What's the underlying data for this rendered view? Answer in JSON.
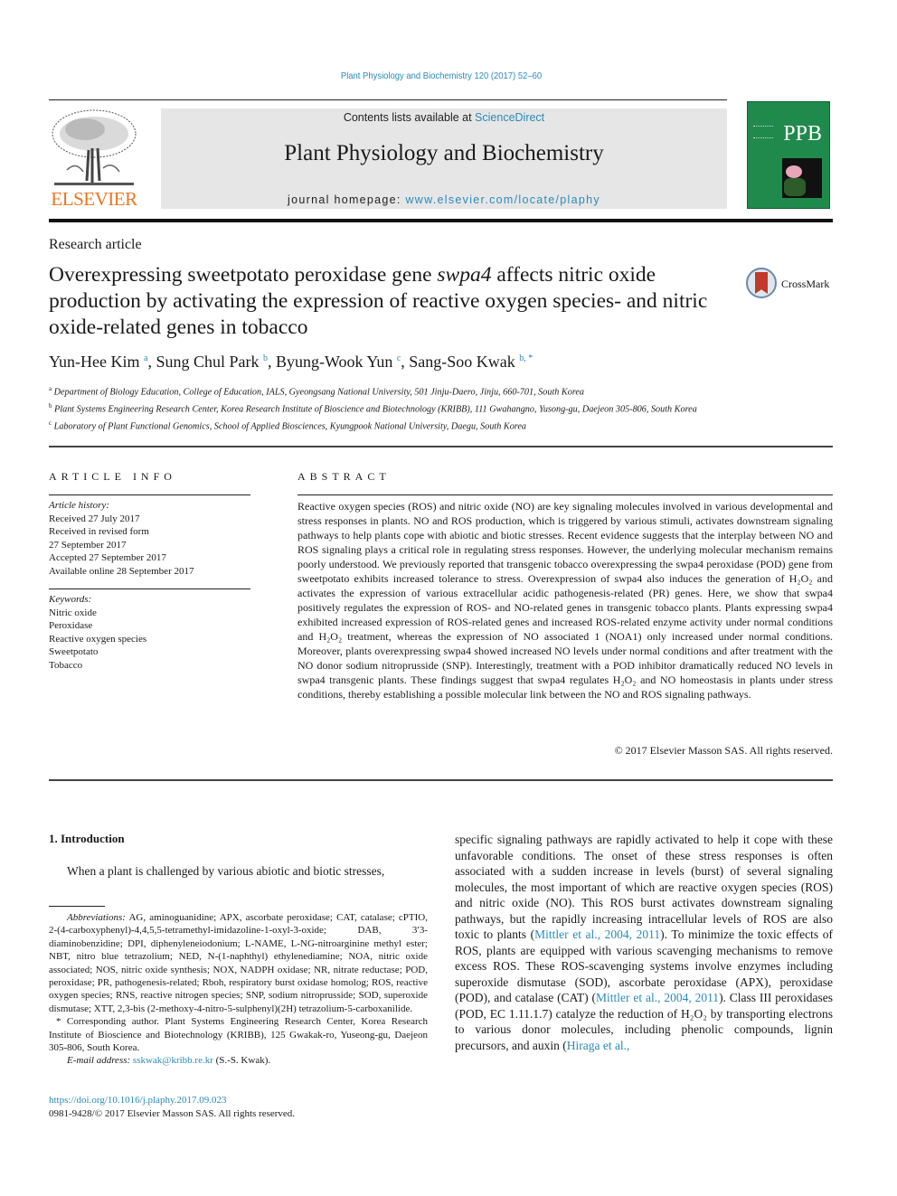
{
  "header": {
    "journal_ref": "Plant Physiology and Biochemistry 120 (2017) 52–60",
    "contents_prefix": "Contents lists available at ",
    "contents_link": "ScienceDirect",
    "journal_title": "Plant Physiology and Biochemistry",
    "homepage_prefix": "journal homepage: ",
    "homepage_link": "www.elsevier.com/locate/plaphy",
    "publisher": "ELSEVIER",
    "cover_label": "PPB",
    "crossmark_label": "CrossMark"
  },
  "article": {
    "type": "Research article",
    "title_part1": "Overexpressing sweetpotato peroxidase gene ",
    "title_gene": "swpa4",
    "title_part2": " affects nitric oxide production by activating the expression of reactive oxygen species- and nitric oxide-related genes in tobacco",
    "authors": [
      {
        "name": "Yun-Hee Kim",
        "sup": "a"
      },
      {
        "name": "Sung Chul Park",
        "sup": "b"
      },
      {
        "name": "Byung-Wook Yun",
        "sup": "c"
      },
      {
        "name": "Sang-Soo Kwak",
        "sup": "b, *"
      }
    ],
    "affiliations": [
      {
        "sup": "a",
        "text": "Department of Biology Education, College of Education, IALS, Gyeongsang National University, 501 Jinju-Daero, Jinju, 660-701, South Korea"
      },
      {
        "sup": "b",
        "text": "Plant Systems Engineering Research Center, Korea Research Institute of Bioscience and Biotechnology (KRIBB), 111 Gwahangno, Yusong-gu, Daejeon 305-806, South Korea"
      },
      {
        "sup": "c",
        "text": "Laboratory of Plant Functional Genomics, School of Applied Biosciences, Kyungpook National University, Daegu, South Korea"
      }
    ]
  },
  "article_info": {
    "heading": "ARTICLE INFO",
    "history_label": "Article history:",
    "history": [
      "Received 27 July 2017",
      "Received in revised form",
      "27 September 2017",
      "Accepted 27 September 2017",
      "Available online 28 September 2017"
    ],
    "keywords_label": "Keywords:",
    "keywords": [
      "Nitric oxide",
      "Peroxidase",
      "Reactive oxygen species",
      "Sweetpotato",
      "Tobacco"
    ]
  },
  "abstract": {
    "heading": "ABSTRACT",
    "text": "Reactive oxygen species (ROS) and nitric oxide (NO) are key signaling molecules involved in various developmental and stress responses in plants. NO and ROS production, which is triggered by various stimuli, activates downstream signaling pathways to help plants cope with abiotic and biotic stresses. Recent evidence suggests that the interplay between NO and ROS signaling plays a critical role in regulating stress responses. However, the underlying molecular mechanism remains poorly understood. We previously reported that transgenic tobacco overexpressing the swpa4 peroxidase (POD) gene from sweetpotato exhibits increased tolerance to stress. Overexpression of swpa4 also induces the generation of H₂O₂ and activates the expression of various extracellular acidic pathogenesis-related (PR) genes. Here, we show that swpa4 positively regulates the expression of ROS- and NO-related genes in transgenic tobacco plants. Plants expressing swpa4 exhibited increased expression of ROS-related genes and increased ROS-related enzyme activity under normal conditions and H₂O₂ treatment, whereas the expression of NO associated 1 (NOA1) only increased under normal conditions. Moreover, plants overexpressing swpa4 showed increased NO levels under normal conditions and after treatment with the NO donor sodium nitroprusside (SNP). Interestingly, treatment with a POD inhibitor dramatically reduced NO levels in swpa4 transgenic plants. These findings suggest that swpa4 regulates H₂O₂ and NO homeostasis in plants under stress conditions, thereby establishing a possible molecular link between the NO and ROS signaling pathways.",
    "copyright": "© 2017 Elsevier Masson SAS. All rights reserved."
  },
  "introduction": {
    "heading": "1.  Introduction",
    "col1_text": "When a plant is challenged by various abiotic and biotic stresses,",
    "col2_segments": [
      {
        "t": "specific signaling pathways are rapidly activated to help it cope with these unfavorable conditions. The onset of these stress responses is often associated with a sudden increase in levels (burst) of several signaling molecules, the most important of which are reactive oxygen species (ROS) and nitric oxide (NO). This ROS burst activates downstream signaling pathways, but the rapidly increasing intracellular levels of ROS are also toxic to plants (",
        "link": false
      },
      {
        "t": "Mittler et al., 2004, 2011",
        "link": true
      },
      {
        "t": "). To minimize the toxic effects of ROS, plants are equipped with various scavenging mechanisms to remove excess ROS. These ROS-scavenging systems involve enzymes including superoxide dismutase (SOD), ascorbate peroxidase (APX), peroxidase (POD), and catalase (CAT) (",
        "link": false
      },
      {
        "t": "Mittler et al., 2004, 2011",
        "link": true
      },
      {
        "t": "). Class III peroxidases (POD, EC 1.11.1.7) catalyze the reduction of H₂O₂ by transporting electrons to various donor molecules, including phenolic compounds, lignin precursors, and auxin (",
        "link": false
      },
      {
        "t": "Hiraga et al.,",
        "link": true
      }
    ]
  },
  "footnotes": {
    "abbrev_label": "Abbreviations:",
    "abbrev_text": " AG, aminoguanidine; APX, ascorbate peroxidase; CAT, catalase; cPTIO, 2-(4-carboxyphenyl)-4,4,5,5-tetramethyl-imidazoline-1-oxyl-3-oxide; DAB, 3′3-diaminobenzidine; DPI, diphenyleneiodonium; L-NAME, L-NG-nitroarginine methyl ester; NBT, nitro blue tetrazolium; NED, N-(1-naphthyl) ethylenediamine; NOA, nitric oxide associated; NOS, nitric oxide synthesis; NOX, NADPH oxidase; NR, nitrate reductase; POD, peroxidase; PR, pathogenesis-related; Rboh, respiratory burst oxidase homolog; ROS, reactive oxygen species; RNS, reactive nitrogen species; SNP, sodium nitroprusside; SOD, superoxide dismutase; XTT, 2,3-bis (2-methoxy-4-nitro-5-sulphenyl)(2H) tetrazolium-5-carboxanilide.",
    "corresponding": "* Corresponding author. Plant Systems Engineering Research Center, Korea Research Institute of Bioscience and Biotechnology (KRIBB), 125 Gwakak-ro, Yuseong-gu, Daejeon 305-806, South Korea.",
    "email_label": "E-mail address:",
    "email": "sskwak@kribb.re.kr",
    "email_suffix": " (S.-S. Kwak).",
    "doi": "https://doi.org/10.1016/j.plaphy.2017.09.023",
    "issn_copyright": "0981-9428/© 2017 Elsevier Masson SAS. All rights reserved."
  }
}
